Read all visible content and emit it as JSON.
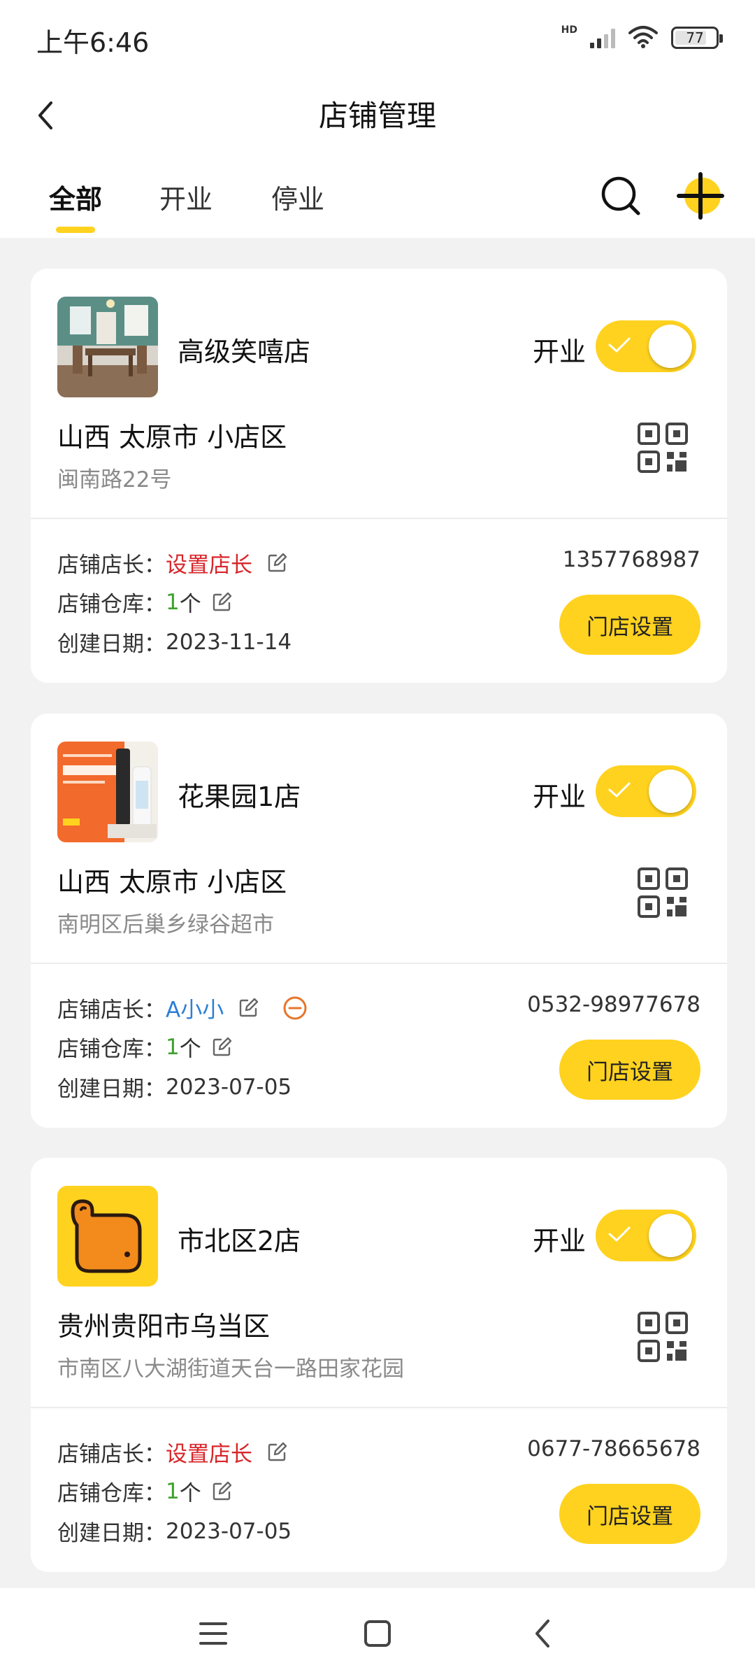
{
  "status_bar": {
    "time": "上午6:46",
    "network_label": "HD",
    "battery": "77",
    "battery_level": 0.77
  },
  "header": {
    "title": "店铺管理"
  },
  "tabs": [
    {
      "label": "全部",
      "active": true
    },
    {
      "label": "开业",
      "active": false
    },
    {
      "label": "停业",
      "active": false
    }
  ],
  "labels": {
    "manager": "店铺店长：",
    "warehouse": "店铺仓库：",
    "created": "创建日期：",
    "open_status": "开业",
    "store_setting": "门店设置"
  },
  "stores": [
    {
      "name": "高级笑嘻店",
      "is_open": true,
      "region": "山西 太原市 小店区",
      "address": "闽南路22号",
      "manager": "设置店长",
      "manager_is_set": false,
      "warehouse_count": "1",
      "warehouse_unit": "个",
      "created_date": "2023-11-14",
      "phone": "1357768987"
    },
    {
      "name": "花果园1店",
      "is_open": true,
      "region": "山西 太原市 小店区",
      "address": "南明区后巢乡绿谷超市",
      "manager": "A小小",
      "manager_is_set": true,
      "warehouse_count": "1",
      "warehouse_unit": "个",
      "created_date": "2023-07-05",
      "phone": "0532-98977678"
    },
    {
      "name": "市北区2店",
      "is_open": true,
      "region": "贵州贵阳市乌当区",
      "address": "市南区八大湖街道天台一路田家花园",
      "manager": "设置店长",
      "manager_is_set": false,
      "warehouse_count": "1",
      "warehouse_unit": "个",
      "created_date": "2023-07-05",
      "phone": "0677-78665678"
    }
  ],
  "colors": {
    "accent": "#ffd21f",
    "manager_unset": "#d8262a",
    "manager_set": "#2c7fd4",
    "warehouse_count": "#3fa12e",
    "remove_manager": "#e8742a"
  },
  "icons": {
    "back": "chevron-left-icon",
    "search": "search-icon",
    "add": "plus-icon",
    "qr": "qr-code-icon",
    "edit": "edit-icon",
    "remove": "minus-circle-icon"
  }
}
